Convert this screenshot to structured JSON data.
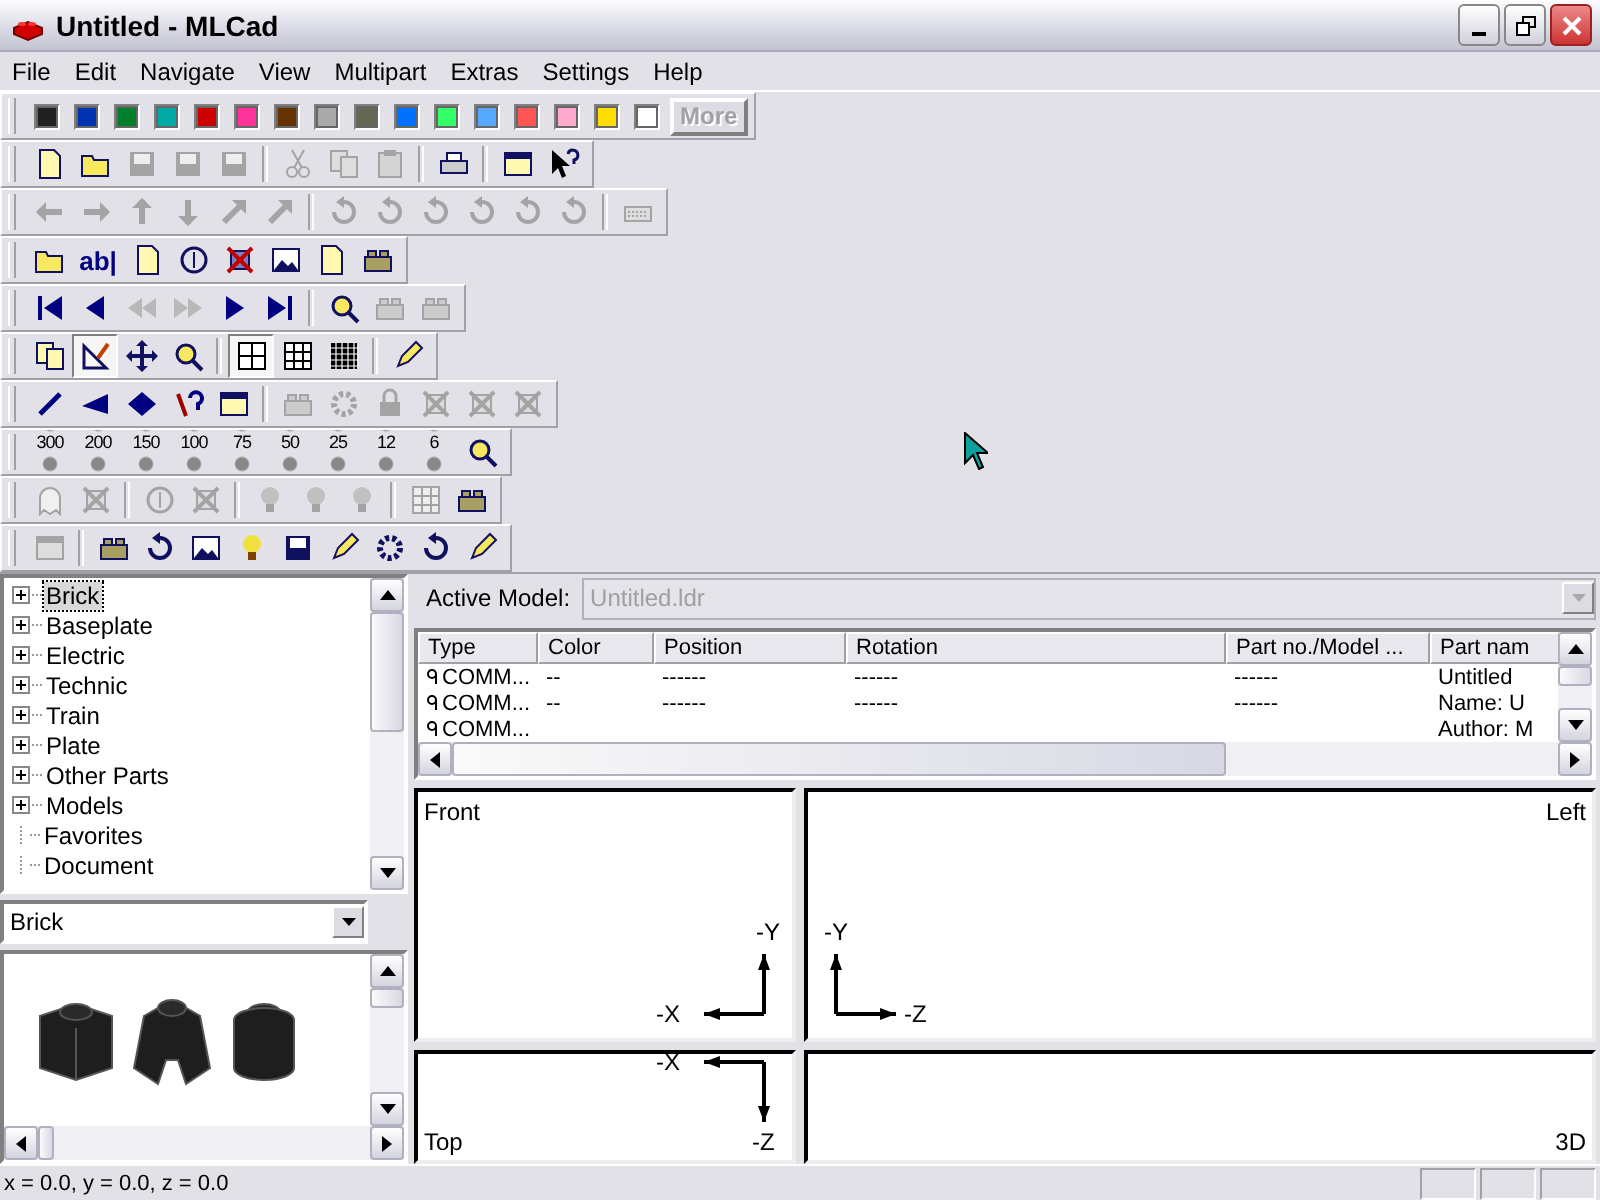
{
  "window": {
    "title": "Untitled - MLCad"
  },
  "menu": [
    "File",
    "Edit",
    "Navigate",
    "View",
    "Multipart",
    "Extras",
    "Settings",
    "Help"
  ],
  "palette": {
    "swatches": [
      {
        "color": "#212121"
      },
      {
        "color": "#0033b2"
      },
      {
        "color": "#00802b"
      },
      {
        "color": "#00aaa4"
      },
      {
        "color": "#cc0000"
      },
      {
        "color": "#ff3399"
      },
      {
        "color": "#663300"
      },
      {
        "color": "#aaaaaa"
      },
      {
        "color": "#666655"
      },
      {
        "color": "#0070ff"
      },
      {
        "color": "#33ff66"
      },
      {
        "color": "#55aaff"
      },
      {
        "color": "#ff5555"
      },
      {
        "color": "#ffaacc"
      },
      {
        "color": "#ffdd00"
      },
      {
        "color": "#ffffff"
      }
    ],
    "more_button": {
      "label": "More",
      "disabled": true
    }
  },
  "toolbars": [
    {
      "items": [
        {
          "kind": "button",
          "disabled": false
        },
        {
          "kind": "button",
          "disabled": false
        },
        {
          "kind": "button",
          "disabled": true
        },
        {
          "kind": "button",
          "disabled": true
        },
        {
          "kind": "button",
          "disabled": true
        },
        {
          "kind": "separator"
        },
        {
          "kind": "button",
          "disabled": true
        },
        {
          "kind": "button",
          "disabled": true
        },
        {
          "kind": "button",
          "disabled": true
        },
        {
          "kind": "separator"
        },
        {
          "kind": "button",
          "disabled": false
        },
        {
          "kind": "separator"
        },
        {
          "kind": "button",
          "disabled": false
        },
        {
          "kind": "button",
          "disabled": false
        }
      ]
    },
    {
      "items": [
        {
          "kind": "button",
          "disabled": true
        },
        {
          "kind": "button",
          "disabled": true
        },
        {
          "kind": "button",
          "disabled": true
        },
        {
          "kind": "button",
          "disabled": true
        },
        {
          "kind": "button",
          "disabled": true
        },
        {
          "kind": "button",
          "disabled": true
        },
        {
          "kind": "separator"
        },
        {
          "kind": "button",
          "disabled": true
        },
        {
          "kind": "button",
          "disabled": true
        },
        {
          "kind": "button",
          "disabled": true
        },
        {
          "kind": "button",
          "disabled": true
        },
        {
          "kind": "button",
          "disabled": true
        },
        {
          "kind": "button",
          "disabled": true
        },
        {
          "kind": "separator"
        },
        {
          "kind": "button",
          "disabled": true
        }
      ]
    },
    {
      "items": [
        {
          "kind": "button",
          "disabled": false
        },
        {
          "kind": "button",
          "disabled": false,
          "label": "ab|"
        },
        {
          "kind": "button",
          "disabled": false
        },
        {
          "kind": "button",
          "disabled": false
        },
        {
          "kind": "button",
          "disabled": false
        },
        {
          "kind": "button",
          "disabled": false
        },
        {
          "kind": "button",
          "disabled": false
        },
        {
          "kind": "button",
          "disabled": false
        }
      ]
    },
    {
      "items": [
        {
          "kind": "button",
          "disabled": false
        },
        {
          "kind": "button",
          "disabled": false
        },
        {
          "kind": "button",
          "disabled": true
        },
        {
          "kind": "button",
          "disabled": true
        },
        {
          "kind": "button",
          "disabled": false
        },
        {
          "kind": "button",
          "disabled": false
        },
        {
          "kind": "separator"
        },
        {
          "kind": "button",
          "disabled": false
        },
        {
          "kind": "button",
          "disabled": true
        },
        {
          "kind": "button",
          "disabled": true
        }
      ]
    },
    {
      "items": [
        {
          "kind": "button",
          "disabled": false,
          "pressed": false
        },
        {
          "kind": "button",
          "disabled": false,
          "pressed": true
        },
        {
          "kind": "button",
          "disabled": false,
          "pressed": false
        },
        {
          "kind": "button",
          "disabled": false,
          "pressed": false
        },
        {
          "kind": "separator"
        },
        {
          "kind": "button",
          "disabled": false,
          "pressed": true
        },
        {
          "kind": "button",
          "disabled": false,
          "pressed": false
        },
        {
          "kind": "button",
          "disabled": false,
          "pressed": false
        },
        {
          "kind": "separator"
        },
        {
          "kind": "button",
          "disabled": false,
          "pressed": false
        }
      ]
    },
    {
      "items": [
        {
          "kind": "button",
          "disabled": false
        },
        {
          "kind": "button",
          "disabled": false
        },
        {
          "kind": "button",
          "disabled": false
        },
        {
          "kind": "button",
          "disabled": false
        },
        {
          "kind": "button",
          "disabled": false
        },
        {
          "kind": "separator"
        },
        {
          "kind": "button",
          "disabled": true
        },
        {
          "kind": "button",
          "disabled": true
        },
        {
          "kind": "button",
          "disabled": true
        },
        {
          "kind": "button",
          "disabled": true
        },
        {
          "kind": "button",
          "disabled": true
        },
        {
          "kind": "button",
          "disabled": true
        }
      ]
    },
    {
      "items": [
        {
          "kind": "button",
          "disabled": false,
          "label": "300"
        },
        {
          "kind": "button",
          "disabled": false,
          "label": "200"
        },
        {
          "kind": "button",
          "disabled": false,
          "label": "150"
        },
        {
          "kind": "button",
          "disabled": false,
          "label": "100"
        },
        {
          "kind": "button",
          "disabled": false,
          "label": "75"
        },
        {
          "kind": "button",
          "disabled": false,
          "label": "50"
        },
        {
          "kind": "button",
          "disabled": false,
          "label": "25"
        },
        {
          "kind": "button",
          "disabled": false,
          "label": "12"
        },
        {
          "kind": "button",
          "disabled": false,
          "label": "6"
        },
        {
          "kind": "button",
          "disabled": false
        }
      ]
    },
    {
      "items": [
        {
          "kind": "button",
          "disabled": true
        },
        {
          "kind": "button",
          "disabled": true
        },
        {
          "kind": "separator"
        },
        {
          "kind": "button",
          "disabled": true
        },
        {
          "kind": "button",
          "disabled": true
        },
        {
          "kind": "separator"
        },
        {
          "kind": "button",
          "disabled": true
        },
        {
          "kind": "button",
          "disabled": true
        },
        {
          "kind": "button",
          "disabled": true
        },
        {
          "kind": "separator"
        },
        {
          "kind": "button",
          "disabled": true
        },
        {
          "kind": "button",
          "disabled": false
        }
      ]
    },
    {
      "items": [
        {
          "kind": "button",
          "disabled": true
        },
        {
          "kind": "separator"
        },
        {
          "kind": "button",
          "disabled": false
        },
        {
          "kind": "button",
          "disabled": false
        },
        {
          "kind": "button",
          "disabled": false
        },
        {
          "kind": "button",
          "disabled": false
        },
        {
          "kind": "button",
          "disabled": false
        },
        {
          "kind": "button",
          "disabled": false
        },
        {
          "kind": "button",
          "disabled": false
        },
        {
          "kind": "button",
          "disabled": false
        },
        {
          "kind": "button",
          "disabled": false
        }
      ]
    }
  ],
  "part_tree": {
    "items": [
      {
        "label": "Brick",
        "kind": "folder",
        "expanded": false,
        "selected": true
      },
      {
        "label": "Baseplate",
        "kind": "folder",
        "expanded": false,
        "selected": false
      },
      {
        "label": "Electric",
        "kind": "folder",
        "expanded": false,
        "selected": false
      },
      {
        "label": "Technic",
        "kind": "folder",
        "expanded": false,
        "selected": false
      },
      {
        "label": "Train",
        "kind": "folder",
        "expanded": false,
        "selected": false
      },
      {
        "label": "Plate",
        "kind": "folder",
        "expanded": false,
        "selected": false
      },
      {
        "label": "Other Parts",
        "kind": "folder",
        "expanded": false,
        "selected": false
      },
      {
        "label": "Models",
        "kind": "folder",
        "expanded": false,
        "selected": false
      },
      {
        "label": "Favorites",
        "kind": "leaf",
        "selected": false
      },
      {
        "label": "Document",
        "kind": "leaf",
        "selected": false
      }
    ]
  },
  "part_category": {
    "value": "Brick"
  },
  "active_model": {
    "label": "Active Model:",
    "value": "Untitled.ldr",
    "disabled": true
  },
  "table": {
    "columns": [
      "Type",
      "Color",
      "Position",
      "Rotation",
      "Part no./Model ...",
      "Part nam"
    ],
    "rows": [
      [
        "COMM...",
        "--",
        "------",
        "------",
        "------",
        "Untitled"
      ],
      [
        "COMM...",
        "--",
        "------",
        "------",
        "------",
        "Name: U"
      ],
      [
        "COMM...",
        "",
        "",
        "",
        "",
        "Author: M"
      ]
    ]
  },
  "views": [
    {
      "kind": "front",
      "label": "Front",
      "axes": [
        "-Y",
        "-X"
      ]
    },
    {
      "kind": "left",
      "label": "Left",
      "axes": [
        "-Y",
        "-Z"
      ]
    },
    {
      "kind": "top",
      "label": "Top",
      "axes": [
        "-Z",
        "-X"
      ]
    },
    {
      "kind": "perspective",
      "label": "3D"
    }
  ],
  "status_bar": {
    "text": "x = 0.0, y = 0.0, z = 0.0"
  }
}
